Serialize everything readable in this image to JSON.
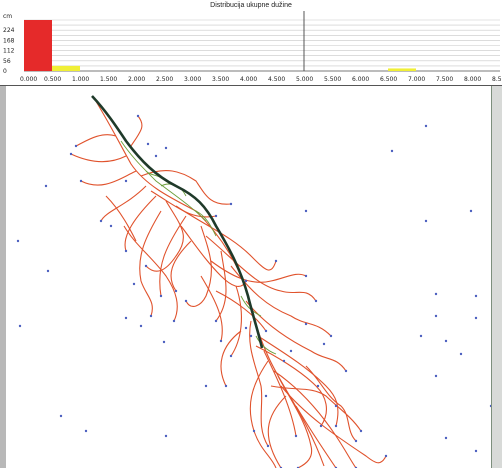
{
  "window": {
    "title": "Distribucija ukupne dužine"
  },
  "histogram": {
    "y_unit": "cm",
    "y_ticks": [
      "224",
      "168",
      "112",
      "56",
      "0"
    ],
    "x_ticks": [
      "0.000",
      "0.500",
      "1.000",
      "1.500",
      "2.000",
      "2.500",
      "3.000",
      "3.500",
      "4.000",
      "4.500",
      "5.000",
      "5.500",
      "6.000",
      "6.500",
      "7.000",
      "7.500",
      "8.000",
      "8.5"
    ],
    "colors": {
      "primary_bar": "#e52a2a",
      "secondary_bar": "#f0ef36",
      "grid": "#c8c8c8",
      "divider": "#444444"
    }
  },
  "chart_data": {
    "type": "bar",
    "title": "Distribucija ukupne dužine",
    "ylabel": "cm",
    "ylim": [
      0,
      280
    ],
    "xlim": [
      0,
      8.5
    ],
    "bars": [
      {
        "x0": 0.0,
        "x1": 0.5,
        "value": 280,
        "color": "#e52a2a"
      },
      {
        "x0": 0.5,
        "x1": 1.0,
        "value": 28,
        "color": "#f0ef36"
      },
      {
        "x0": 6.5,
        "x1": 7.0,
        "value": 14,
        "color": "#f0ef36"
      }
    ]
  },
  "scan": {
    "colors": {
      "background": "#ffffff",
      "root": "#e0522c",
      "tap_root": "#1f3a2a",
      "tip": "#4b5fbf"
    }
  }
}
